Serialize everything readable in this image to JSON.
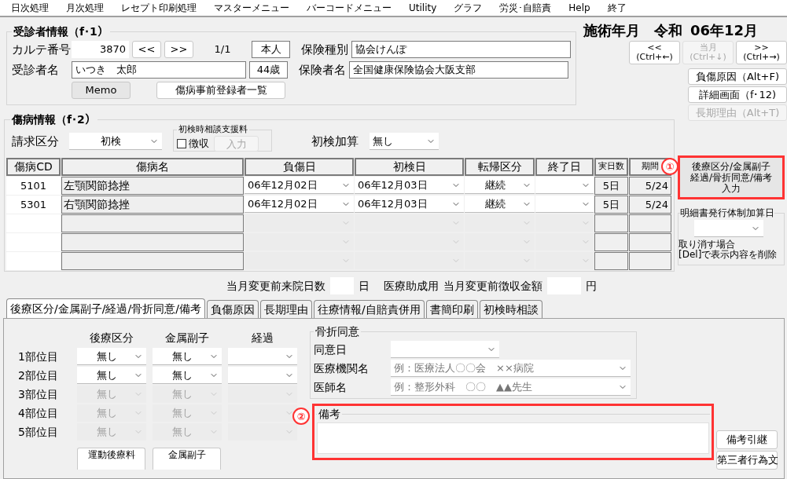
{
  "menu": [
    "日次処理",
    "月次処理",
    "レセプト印刷処理",
    "マスターメニュー",
    "バーコードメニュー",
    "Utility",
    "グラフ",
    "労災･自賠責",
    "Help",
    "終了"
  ],
  "patient": {
    "title": "受診者情報（f･1）",
    "chart_no_label": "カルテ番号",
    "chart_no": "3870",
    "prev": "<<",
    "next": ">>",
    "page": "1/1",
    "relation": "本人",
    "insurance_type_label": "保険種別",
    "insurance_type": "協会けんぽ",
    "name_label": "受診者名",
    "name": "いつき　太郎",
    "age": "44歳",
    "insurer_label": "保険者名",
    "insurer": "全国健康保険協会大阪支部",
    "memo": "Memo",
    "list_button": "傷病事前登録者一覧"
  },
  "month": {
    "label": "施術年月",
    "era": "令和",
    "value": "06年12月",
    "buttons": [
      {
        "label": "<<",
        "shortcut": "(Ctrl+←)",
        "disabled": false
      },
      {
        "label": "当月",
        "shortcut": "(Ctrl+↓)",
        "disabled": true
      },
      {
        "label": ">>",
        "shortcut": "(Ctrl+→)",
        "disabled": false
      }
    ]
  },
  "side_buttons": [
    {
      "label": "負傷原因（Alt+F)",
      "disabled": false
    },
    {
      "label": "詳細画面（f･12)",
      "disabled": false
    },
    {
      "label": "長期理由（Alt+T)",
      "disabled": true
    }
  ],
  "injury": {
    "title": "傷病情報（f･2）",
    "billing_label": "請求区分",
    "billing": "初検",
    "consult_group": "初検時相談支援料",
    "collect": {
      "label": "徴収",
      "checked": false
    },
    "input_button": {
      "label": "入力",
      "disabled": true
    },
    "addition_label": "初検加算",
    "addition": "無し",
    "columns": [
      "傷病CD",
      "傷病名",
      "負傷日",
      "初検日",
      "転帰区分",
      "終了日",
      "実日数",
      "期間"
    ],
    "rows": [
      {
        "code": "5101",
        "name": "左顎関節捻挫",
        "injury_date": "06年12月02日",
        "first_date": "06年12月03日",
        "outcome": "継続",
        "days": "5日",
        "period": "5/24",
        "enabled": true
      },
      {
        "code": "5301",
        "name": "右顎関節捻挫",
        "injury_date": "06年12月02日",
        "first_date": "06年12月03日",
        "outcome": "継続",
        "days": "5日",
        "period": "5/24",
        "enabled": true
      },
      {
        "enabled": false
      },
      {
        "enabled": false
      },
      {
        "enabled": false
      }
    ]
  },
  "entry_button": {
    "lines": [
      "後療区分/金属副子",
      "経過/骨折同意/備考",
      "入力"
    ],
    "annotation": "①"
  },
  "statement_group": {
    "title": "明細書発行体制加算日",
    "note": [
      "取り消す場合",
      "[Del]で表示内容を削除"
    ]
  },
  "before_change": {
    "visits_label": "当月変更前来院日数",
    "visits_unit": "日",
    "subsidy_label": "医療助成用",
    "amount_label": "当月変更前徴収金額",
    "amount_unit": "円"
  },
  "tabs": [
    {
      "label": "後療区分/金属副子/経過/骨折同意/備考",
      "selected": true
    },
    {
      "label": "負傷原因",
      "selected": false
    },
    {
      "label": "長期理由",
      "selected": false
    },
    {
      "label": "往療情報/自賠責併用",
      "selected": false
    },
    {
      "label": "書簡印刷",
      "selected": false
    },
    {
      "label": "初検時相談",
      "selected": false
    }
  ],
  "parts": {
    "columns": [
      "後療区分",
      "金属副子",
      "経過"
    ],
    "rows": [
      {
        "label": "1部位目",
        "aftercare": "無し",
        "splint": "無し",
        "enabled": true
      },
      {
        "label": "2部位目",
        "aftercare": "無し",
        "splint": "無し",
        "enabled": true
      },
      {
        "label": "3部位目",
        "aftercare": "無し",
        "splint": "無し",
        "enabled": false
      },
      {
        "label": "4部位目",
        "aftercare": "無し",
        "splint": "無し",
        "enabled": false
      },
      {
        "label": "5部位目",
        "aftercare": "無し",
        "splint": "無し",
        "enabled": false
      }
    ],
    "buttons": [
      "運動後療料",
      "金属副子"
    ]
  },
  "fracture": {
    "title": "骨折同意",
    "date_label": "同意日",
    "institution_label": "医療機関名",
    "institution_placeholder": "例：医療法人〇〇会　××病院",
    "doctor_label": "医師名",
    "doctor_placeholder": "例：整形外科　〇〇　▲▲先生"
  },
  "remarks": {
    "title": "備考",
    "annotation": "②",
    "buttons": [
      "備考引継",
      "第三者行為文"
    ]
  }
}
